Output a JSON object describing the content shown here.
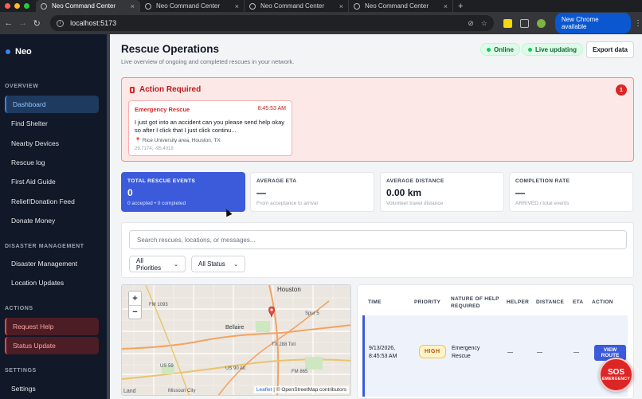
{
  "browser": {
    "tabs": [
      "Neo Command Center",
      "Neo Command Center",
      "Neo Command Center",
      "Neo Command Center"
    ],
    "url": "localhost:5173",
    "chrome_notice": "New Chrome available"
  },
  "sidebar": {
    "brand": "Neo",
    "sections": {
      "overview": "OVERVIEW",
      "disaster": "DISASTER MANAGEMENT",
      "actions": "ACTIONS",
      "settings": "SETTINGS"
    },
    "overview_items": [
      "Dashboard",
      "Find Shelter",
      "Nearby Devices",
      "Rescue log",
      "First Aid Guide",
      "Relief/Donation Feed",
      "Donate Money"
    ],
    "disaster_items": [
      "Disaster Management",
      "Location Updates"
    ],
    "action_items": [
      "Request Help",
      "Status Update"
    ],
    "settings_items": [
      "Settings"
    ]
  },
  "header": {
    "title": "Rescue Operations",
    "subtitle": "Live overview of ongoing and completed rescues in your network.",
    "online": "Online",
    "live": "Live updating",
    "export": "Export data"
  },
  "alert": {
    "title": "Action Required",
    "count": "1",
    "card": {
      "type": "Emergency Rescue",
      "time": "8:45:53 AM",
      "message": "I just got into an accident can you please send help okay so after I click that I just click continu...",
      "location": "Rice University area, Houston, TX",
      "coords": "29.7174, -95.4018"
    }
  },
  "stats": [
    {
      "label": "TOTAL RESCUE EVENTS",
      "value": "0",
      "hint": "0 accepted • 0 completed"
    },
    {
      "label": "AVERAGE ETA",
      "value": "—",
      "hint": "From acceptance to arrival"
    },
    {
      "label": "AVERAGE DISTANCE",
      "value": "0.00 km",
      "hint": "Volunteer travel distance"
    },
    {
      "label": "COMPLETION RATE",
      "value": "—",
      "hint": "ARRIVED / total events"
    }
  ],
  "filters": {
    "search_placeholder": "Search rescues, locations, or messages...",
    "priority": "All Priorities",
    "status": "All Status"
  },
  "map": {
    "labels": [
      "Houston",
      "FM 1093",
      "Spur 5",
      "Bellaire",
      "TX 288 Toll",
      "US 59",
      "US 90 Alt",
      "FM 865",
      "Missouri City",
      "Land"
    ],
    "attribution_leaflet": "Leaflet",
    "attribution_rest": "| © OpenStreetMap contributors"
  },
  "table": {
    "headers": [
      "TIME",
      "PRIORITY",
      "NATURE OF HELP REQUIRED",
      "HELPER",
      "DISTANCE",
      "ETA",
      "ACTION"
    ],
    "row": {
      "time": "9/13/2026, 8:45:53 AM",
      "priority": "HIGH",
      "nature": "Emergency Rescue",
      "helper": "—",
      "distance": "—",
      "eta": "—",
      "action": "VIEW ROUTE"
    }
  },
  "sos": {
    "main": "SOS",
    "sub": "EMERGENCY"
  },
  "colors": {
    "accent": "#3b5bdb",
    "danger": "#dc2626",
    "success": "#22c55e"
  }
}
